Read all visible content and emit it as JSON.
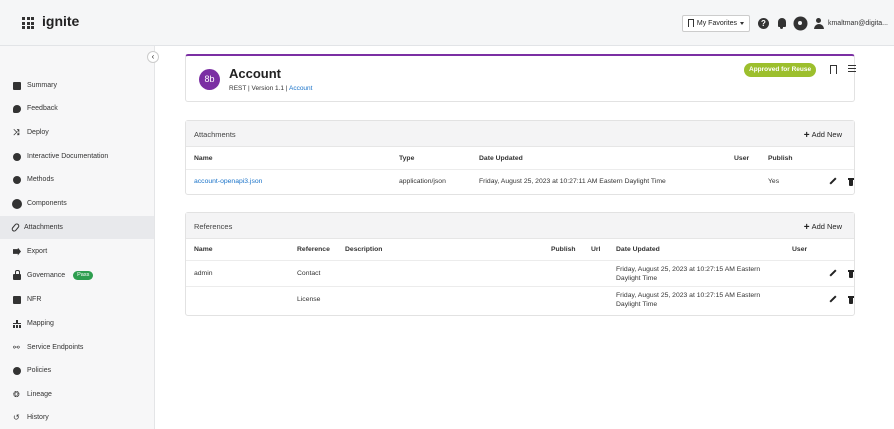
{
  "topbar": {
    "app_name": "ignite",
    "favorites_label": "My Favorites",
    "user_email": "kmaltman@digita..."
  },
  "sidebar": {
    "collapse_glyph": "‹",
    "items": [
      {
        "label": "Summary",
        "icon": "document-icon"
      },
      {
        "label": "Feedback",
        "icon": "comment-icon"
      },
      {
        "label": "Deploy",
        "icon": "shuffle-icon"
      },
      {
        "label": "Interactive Documentation",
        "icon": "circle-icon"
      },
      {
        "label": "Methods",
        "icon": "circle-icon"
      },
      {
        "label": "Components",
        "icon": "gear-icon"
      },
      {
        "label": "Attachments",
        "icon": "paperclip-icon",
        "active": true
      },
      {
        "label": "Export",
        "icon": "export-icon"
      },
      {
        "label": "Governance",
        "icon": "lock-icon",
        "badge": "Pass"
      },
      {
        "label": "NFR",
        "icon": "document-icon"
      },
      {
        "label": "Mapping",
        "icon": "sitemap-icon"
      },
      {
        "label": "Service Endpoints",
        "icon": "network-icon"
      },
      {
        "label": "Policies",
        "icon": "circle-icon"
      },
      {
        "label": "Lineage",
        "icon": "lineage-icon"
      },
      {
        "label": "History",
        "icon": "history-icon"
      }
    ]
  },
  "header": {
    "avatar_text": "8b",
    "title": "Account",
    "subtitle_prefix": "REST | Version 1.1 | ",
    "subtitle_link": "Account",
    "status_badge": "Approved for Reuse",
    "accent_color": "#7b2fa3",
    "badge_color": "#9cbf2d"
  },
  "attachments": {
    "title": "Attachments",
    "add_label": "Add New",
    "columns": [
      "Name",
      "Type",
      "Date Updated",
      "User",
      "Publish"
    ],
    "rows": [
      {
        "name": "account-openapi3.json",
        "type": "application/json",
        "date": "Friday, August 25, 2023 at 10:27:11 AM Eastern Daylight Time",
        "user": "",
        "publish": "Yes"
      }
    ]
  },
  "references": {
    "title": "References",
    "add_label": "Add New",
    "columns": [
      "Name",
      "Reference",
      "Description",
      "Publish",
      "Url",
      "Date Updated",
      "User"
    ],
    "rows": [
      {
        "name": "admin",
        "reference": "Contact",
        "description": "",
        "publish": "",
        "url": "",
        "date_line1": "Friday, August 25, 2023 at 10:27:15 AM Eastern",
        "date_line2": "Daylight Time",
        "user": ""
      },
      {
        "name": "",
        "reference": "License",
        "description": "",
        "publish": "",
        "url": "",
        "date_line1": "Friday, August 25, 2023 at 10:27:15 AM Eastern",
        "date_line2": "Daylight Time",
        "user": ""
      }
    ]
  }
}
